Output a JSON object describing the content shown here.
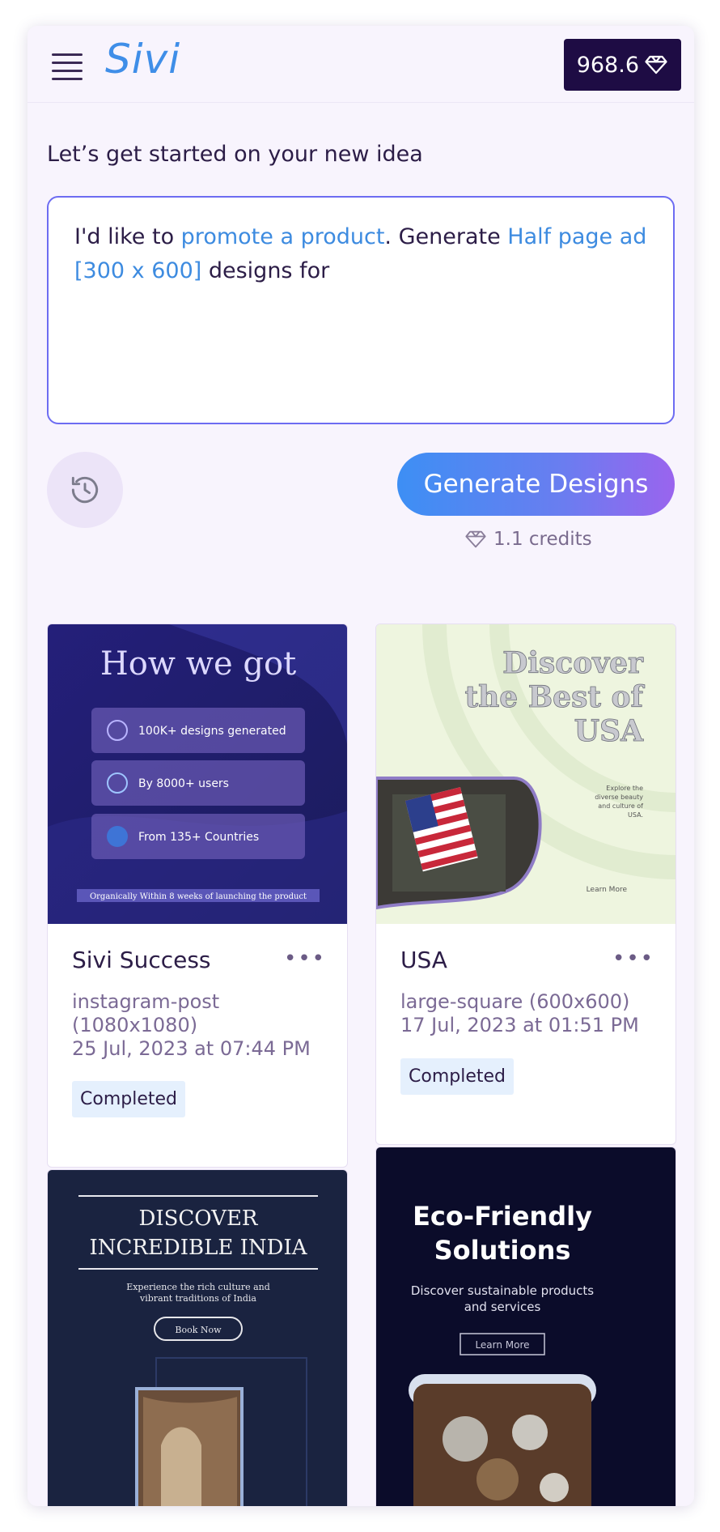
{
  "header": {
    "logo": "Sivi",
    "credits_balance": "968.6"
  },
  "intro": {
    "heading": "Let’s get started on your new idea"
  },
  "prompt": {
    "part1": "I'd like to ",
    "goal": "promote a product",
    "part2": ". Generate ",
    "size": "Half page ad [300 x 600]",
    "part3": " designs for"
  },
  "actions": {
    "generate_label": "Generate Designs",
    "cost": "1.1 credits"
  },
  "cards": [
    {
      "title": "Sivi Success",
      "format": "instagram-post (1080x1080)",
      "date": "25 Jul, 2023 at 07:44 PM",
      "status": "Completed",
      "menu": "•••",
      "thumb": {
        "headline": "How we got",
        "stats": [
          "100K+ designs generated",
          "By 8000+ users",
          "From 135+ Countries"
        ],
        "footer": "Organically Within 8 weeks of launching the product"
      }
    },
    {
      "title": "USA",
      "format": "large-square (600x600)",
      "date": "17 Jul, 2023 at 01:51 PM",
      "status": "Completed",
      "menu": "•••",
      "thumb": {
        "headline": "Discover the Best of USA",
        "body": "Explore the diverse beauty and culture of USA.",
        "cta": "Learn More"
      }
    },
    {
      "thumb": {
        "headline": "DISCOVER INCREDIBLE INDIA",
        "body": "Experience the rich culture and vibrant traditions of India",
        "cta": "Book Now"
      }
    },
    {
      "thumb": {
        "headline": "Eco-Friendly Solutions",
        "body": "Discover sustainable products and services",
        "cta": "Learn More"
      }
    }
  ]
}
